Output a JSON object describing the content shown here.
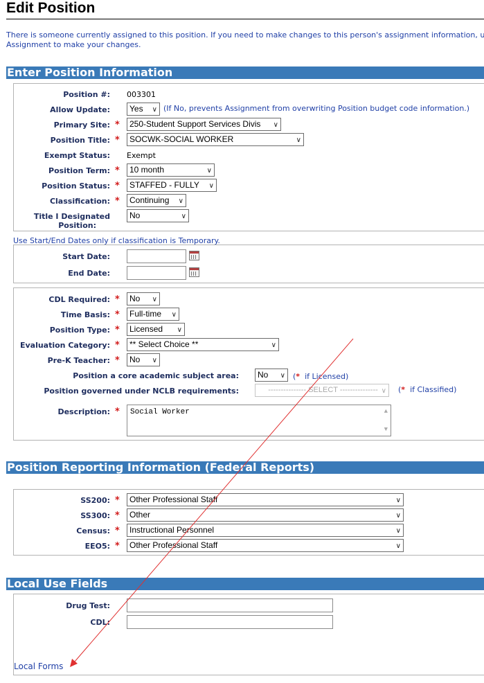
{
  "page": {
    "title": "Edit Position",
    "notice_line1": "There is someone currently assigned to this position. If you need to make changes to this person's assignment information, use",
    "notice_line2": "Assignment to make your changes."
  },
  "section_position": {
    "header": "Enter Position Information",
    "position_number": {
      "label": "Position #:",
      "value": "003301"
    },
    "allow_update": {
      "label": "Allow Update:",
      "value": "Yes",
      "hint": "(If No, prevents Assignment from overwriting Position budget code information.)"
    },
    "primary_site": {
      "label": "Primary Site:",
      "value": "250-Student Support Services Divis"
    },
    "position_title": {
      "label": "Position Title:",
      "value": "SOCWK-SOCIAL WORKER"
    },
    "exempt_status": {
      "label": "Exempt Status:",
      "value": "Exempt"
    },
    "position_term": {
      "label": "Position Term:",
      "value": "10 month"
    },
    "position_status": {
      "label": "Position Status:",
      "value": "STAFFED - FULLY"
    },
    "classification": {
      "label": "Classification:",
      "value": "Continuing"
    },
    "title_one": {
      "label_line1": "Title I Designated",
      "label_line2": "Position:",
      "value": "No"
    }
  },
  "dates": {
    "note": "Use Start/End Dates only if classification is Temporary.",
    "start_label": "Start Date:",
    "start_value": "",
    "end_label": "End Date:",
    "end_value": ""
  },
  "details": {
    "cdl_required": {
      "label": "CDL Required:",
      "value": "No"
    },
    "time_basis": {
      "label": "Time Basis:",
      "value": "Full-time"
    },
    "position_type": {
      "label": "Position Type:",
      "value": "Licensed"
    },
    "evaluation_category": {
      "label": "Evaluation Category:",
      "value": "** Select Choice **"
    },
    "prek_teacher": {
      "label": "Pre-K Teacher:",
      "value": "No"
    },
    "core_academic": {
      "label": "Position a core academic subject area:",
      "value": "No",
      "hint": "if Licensed)"
    },
    "nclb": {
      "label": "Position governed under NCLB requirements:",
      "value": "--------------- SELECT ---------------",
      "hint": "if Classified)"
    },
    "description": {
      "label": "Description:",
      "value": "Social Worker"
    },
    "hint_open": "(",
    "required_mark": "*"
  },
  "section_reporting": {
    "header": "Position Reporting Information (Federal Reports)",
    "ss200": {
      "label": "SS200:",
      "value": "Other Professional Staff"
    },
    "ss300": {
      "label": "SS300:",
      "value": "Other"
    },
    "census": {
      "label": "Census:",
      "value": "Instructional Personnel"
    },
    "eeo5": {
      "label": "EEO5:",
      "value": "Other Professional Staff"
    }
  },
  "section_local": {
    "header": "Local Use Fields",
    "drug_test": {
      "label": "Drug Test:",
      "value": ""
    },
    "cdl": {
      "label": "CDL:",
      "value": ""
    },
    "local_forms_link": "Local Forms"
  },
  "annotation": {
    "color": "#e03030",
    "description": "arrow pointing to Local Forms link"
  },
  "colors": {
    "section_header_bg": "#3a7ab8",
    "label_text": "#1e2d5e",
    "link_blue": "#1f3fa6",
    "required_red": "#d21b1b"
  }
}
